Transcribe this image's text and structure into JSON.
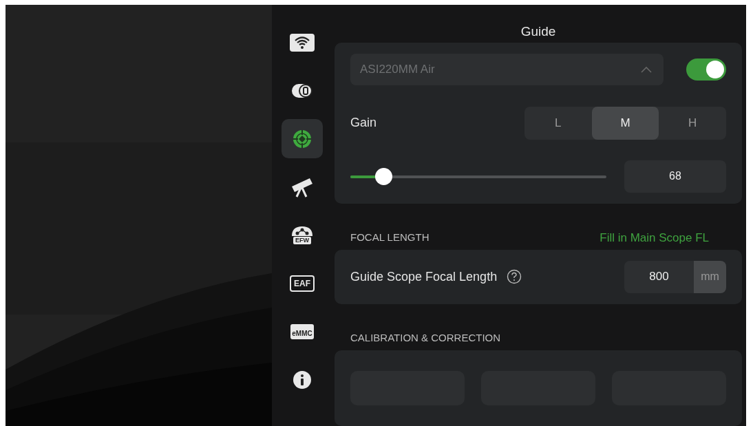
{
  "sidebar": {
    "items": [
      {
        "kind": "wifi",
        "selected": false
      },
      {
        "kind": "camera",
        "selected": false
      },
      {
        "kind": "guide",
        "selected": true
      },
      {
        "kind": "telescope",
        "selected": false
      },
      {
        "kind": "efw",
        "badge": "EFW",
        "selected": false
      },
      {
        "kind": "eaf",
        "badge": "EAF",
        "selected": false
      },
      {
        "kind": "emmc",
        "badge": "eMMC",
        "selected": false
      },
      {
        "kind": "info",
        "selected": false
      }
    ]
  },
  "title": "Guide",
  "camera": {
    "device": "ASI220MM Air",
    "on": true,
    "gain": {
      "label": "Gain",
      "options": [
        {
          "label": "L",
          "selected": false
        },
        {
          "label": "M",
          "selected": true
        },
        {
          "label": "H",
          "selected": false
        }
      ],
      "level": 0.13,
      "value": "68"
    }
  },
  "focal_length": {
    "heading": "FOCAL LENGTH",
    "link": "Fill in Main Scope FL",
    "label": "Guide Scope Focal Length",
    "value": "800",
    "unit": "mm"
  },
  "calibration": {
    "heading": "CALIBRATION & CORRECTION",
    "buttons": [
      {
        "kind": "button"
      },
      {
        "kind": "button"
      },
      {
        "kind": "button"
      }
    ]
  }
}
